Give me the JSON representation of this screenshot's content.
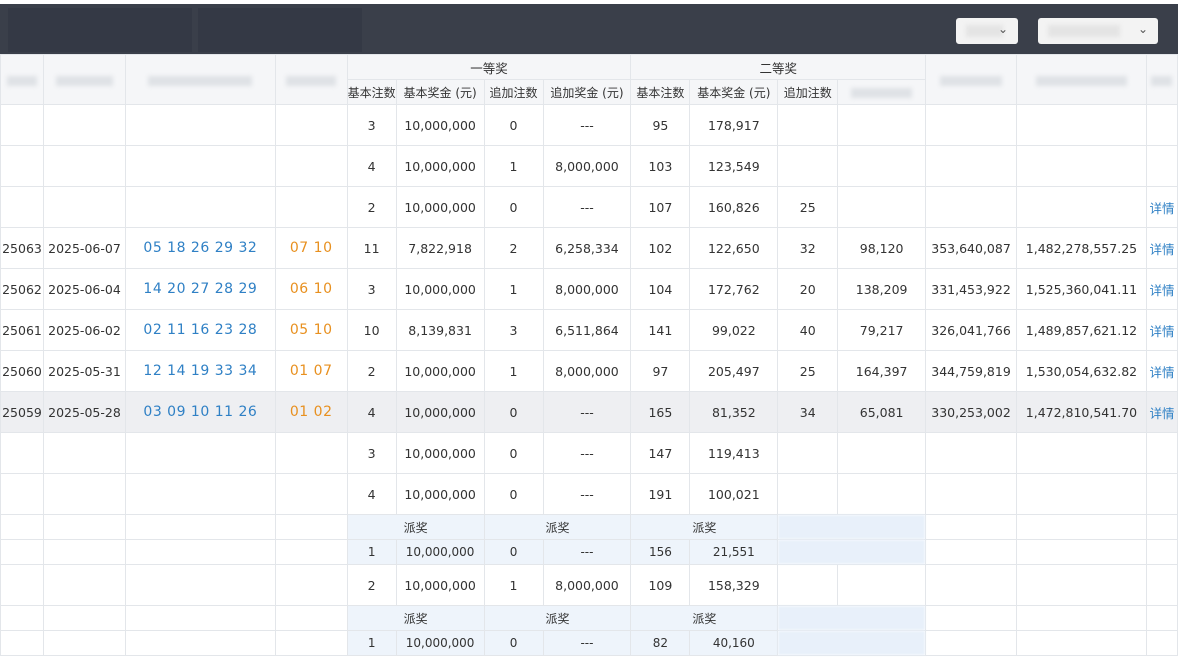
{
  "header": {
    "prize1": "一等奖",
    "prize2": "二等奖",
    "sub": [
      "基本注数",
      "基本奖金 (元)",
      "追加注数",
      "追加奖金 (元)",
      "基本注数",
      "基本奖金 (元)",
      "追加注数"
    ]
  },
  "rows": [
    {
      "issue": "",
      "date": "",
      "front": "",
      "back": "",
      "b1n": "3",
      "b1a": "10,000,000",
      "a1n": "0",
      "a1a": "---",
      "b2n": "95",
      "b2a": "178,917",
      "a2n": "",
      "a2a": "",
      "sales": "",
      "pool": "",
      "detail": ""
    },
    {
      "issue": "",
      "date": "",
      "front": "",
      "back": "",
      "b1n": "4",
      "b1a": "10,000,000",
      "a1n": "1",
      "a1a": "8,000,000",
      "b2n": "103",
      "b2a": "123,549",
      "a2n": "",
      "a2a": "",
      "sales": "",
      "pool": "",
      "detail": ""
    },
    {
      "issue": "",
      "date": "",
      "front": "",
      "back": "",
      "b1n": "2",
      "b1a": "10,000,000",
      "a1n": "0",
      "a1a": "---",
      "b2n": "107",
      "b2a": "160,826",
      "a2n": "25",
      "a2a": "",
      "sales": "",
      "pool": "",
      "detail": "详情"
    },
    {
      "issue": "25063",
      "date": "2025-06-07",
      "front": "05 18 26 29 32",
      "back": "07 10",
      "b1n": "11",
      "b1a": "7,822,918",
      "a1n": "2",
      "a1a": "6,258,334",
      "b2n": "102",
      "b2a": "122,650",
      "a2n": "32",
      "a2a": "98,120",
      "sales": "353,640,087",
      "pool": "1,482,278,557.25",
      "detail": "详情"
    },
    {
      "issue": "25062",
      "date": "2025-06-04",
      "front": "14 20 27 28 29",
      "back": "06 10",
      "b1n": "3",
      "b1a": "10,000,000",
      "a1n": "1",
      "a1a": "8,000,000",
      "b2n": "104",
      "b2a": "172,762",
      "a2n": "20",
      "a2a": "138,209",
      "sales": "331,453,922",
      "pool": "1,525,360,041.11",
      "detail": "详情"
    },
    {
      "issue": "25061",
      "date": "2025-06-02",
      "front": "02 11 16 23 28",
      "back": "05 10",
      "b1n": "10",
      "b1a": "8,139,831",
      "a1n": "3",
      "a1a": "6,511,864",
      "b2n": "141",
      "b2a": "99,022",
      "a2n": "40",
      "a2a": "79,217",
      "sales": "326,041,766",
      "pool": "1,489,857,621.12",
      "detail": "详情"
    },
    {
      "issue": "25060",
      "date": "2025-05-31",
      "front": "12 14 19 33 34",
      "back": "01 07",
      "b1n": "2",
      "b1a": "10,000,000",
      "a1n": "1",
      "a1a": "8,000,000",
      "b2n": "97",
      "b2a": "205,497",
      "a2n": "25",
      "a2a": "164,397",
      "sales": "344,759,819",
      "pool": "1,530,054,632.82",
      "detail": "详情"
    },
    {
      "issue": "25059",
      "date": "2025-05-28",
      "front": "03 09 10 11 26",
      "back": "01 02",
      "b1n": "4",
      "b1a": "10,000,000",
      "a1n": "0",
      "a1a": "---",
      "b2n": "165",
      "b2a": "81,352",
      "a2n": "34",
      "a2a": "65,081",
      "sales": "330,253,002",
      "pool": "1,472,810,541.70",
      "detail": "详情"
    },
    {
      "issue": "",
      "date": "",
      "front": "",
      "back": "",
      "b1n": "3",
      "b1a": "10,000,000",
      "a1n": "0",
      "a1a": "---",
      "b2n": "147",
      "b2a": "119,413",
      "a2n": "",
      "a2a": "",
      "sales": "",
      "pool": "",
      "detail": ""
    },
    {
      "issue": "",
      "date": "",
      "front": "",
      "back": "",
      "b1n": "4",
      "b1a": "10,000,000",
      "a1n": "0",
      "a1a": "---",
      "b2n": "191",
      "b2a": "100,021",
      "a2n": "",
      "a2a": "",
      "sales": "",
      "pool": "",
      "detail": ""
    }
  ],
  "payout1": {
    "label": "派奖",
    "b1n": "1",
    "b1a": "10,000,000",
    "a1n": "0",
    "a1a": "---",
    "b2n": "156",
    "b2a": "21,551"
  },
  "row11": {
    "b1n": "2",
    "b1a": "10,000,000",
    "a1n": "1",
    "a1a": "8,000,000",
    "b2n": "109",
    "b2a": "158,329"
  },
  "payout2": {
    "label": "派奖",
    "b1n": "1",
    "b1a": "10,000,000",
    "a1n": "0",
    "a1a": "---",
    "b2n": "82",
    "b2a": "40,160"
  },
  "colors": {
    "topbar": "#3a3f4a",
    "blue": "#2f80c5",
    "orange": "#e8901f",
    "highlight": "#eeeff2",
    "subrow": "#eef4fb"
  }
}
